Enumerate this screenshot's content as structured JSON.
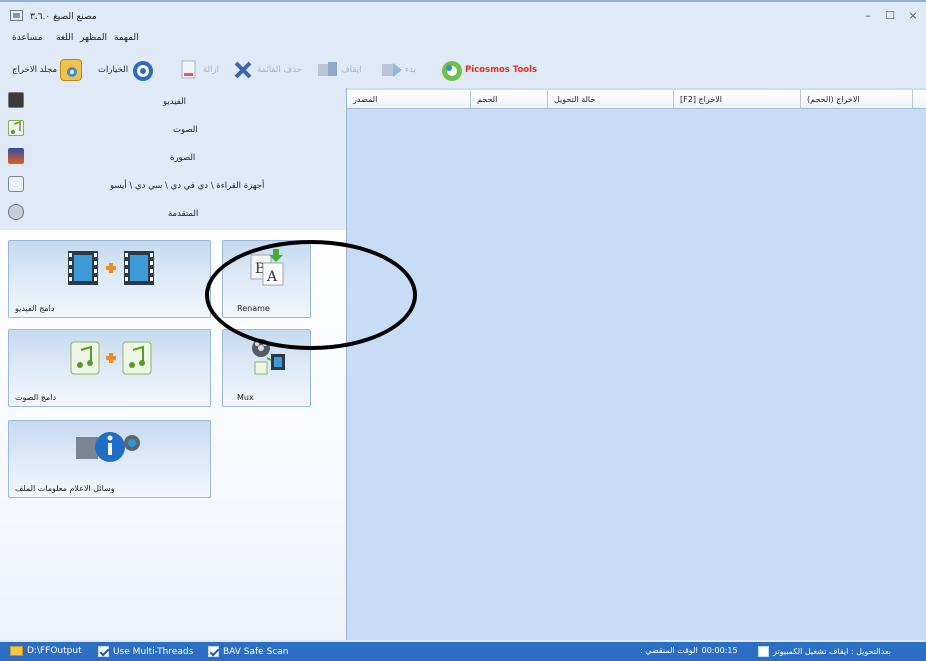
{
  "window": {
    "title": "مصنع الصيغ ٣.٦.٠",
    "controls": {
      "minimize": "–",
      "maximize": "☐",
      "close": "×"
    }
  },
  "menu": {
    "items": [
      "مساعدة",
      "اللغة",
      "المظهر",
      "المهمة"
    ]
  },
  "toolbar": {
    "output_folder": "مجلد الاخراج",
    "options": "الخيارات",
    "remove": "ازالة",
    "clear_list": "حذف القائمة",
    "stop": "ايقاف",
    "start": "بدء",
    "picosmos": "Picosmos Tools"
  },
  "categories": [
    "الفيديو",
    "الصوت",
    "الصورة",
    "أجهزة القراءة \\ دي في دي \\ سي دي \\ أيسو",
    "المتقدمة"
  ],
  "tools": {
    "video_joiner": "دامج الفيديو",
    "rename": "Rename",
    "audio_joiner": "دامج الصوت",
    "mux": "Mux",
    "media_info": "وسائل الاعلام معلومات الملف"
  },
  "list": {
    "columns": [
      "المصدر",
      "الحجم",
      "حالة التحويل",
      "[F2] الاخراج",
      "(الاخراج (الحجم"
    ]
  },
  "status": {
    "output_path": "D:\\FFOutput",
    "multi_threads": "Use Multi-Threads",
    "bav_scan": "BAV Safe Scan",
    "after_convert": "بعدالتحويل : ايقاف تشغيل الكمبيوتر",
    "elapsed_value": "00:00:15",
    "elapsed_label": ": الوقت المنقضي"
  },
  "colors": {
    "accent": "#2a6fc4",
    "window_bg": "#dfeaf6",
    "list_bg": "#c9dcf5",
    "annotation": "#000000"
  }
}
